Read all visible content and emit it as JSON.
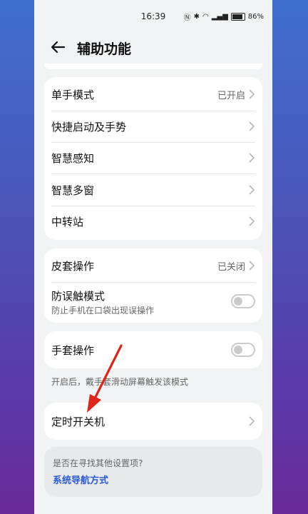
{
  "status_bar": {
    "time": "16:39",
    "battery_text": "86%",
    "battery_level": 0.86
  },
  "header": {
    "title": "辅助功能"
  },
  "group1": {
    "items": [
      {
        "label": "单手模式",
        "value": "已开启"
      },
      {
        "label": "快捷启动及手势",
        "value": ""
      },
      {
        "label": "智慧感知",
        "value": ""
      },
      {
        "label": "智慧多窗",
        "value": ""
      },
      {
        "label": "中转站",
        "value": ""
      }
    ]
  },
  "group2": {
    "flip_cover": {
      "label": "皮套操作",
      "value": "已关闭"
    },
    "anti_touch": {
      "label": "防误触模式",
      "sub": "防止手机在口袋出现误操作",
      "enabled": false
    }
  },
  "gloves": {
    "label": "手套操作",
    "enabled": false,
    "note": "开启后，戴手套滑动屏幕触发该模式"
  },
  "schedule": {
    "label": "定时开关机"
  },
  "suggestion": {
    "question": "是否在寻找其他设置项?",
    "link": "系统导航方式"
  },
  "colors": {
    "accent": "#2b5ad6",
    "annotation_arrow": "#e0231b",
    "screen_bg": "#f1f3f5"
  }
}
